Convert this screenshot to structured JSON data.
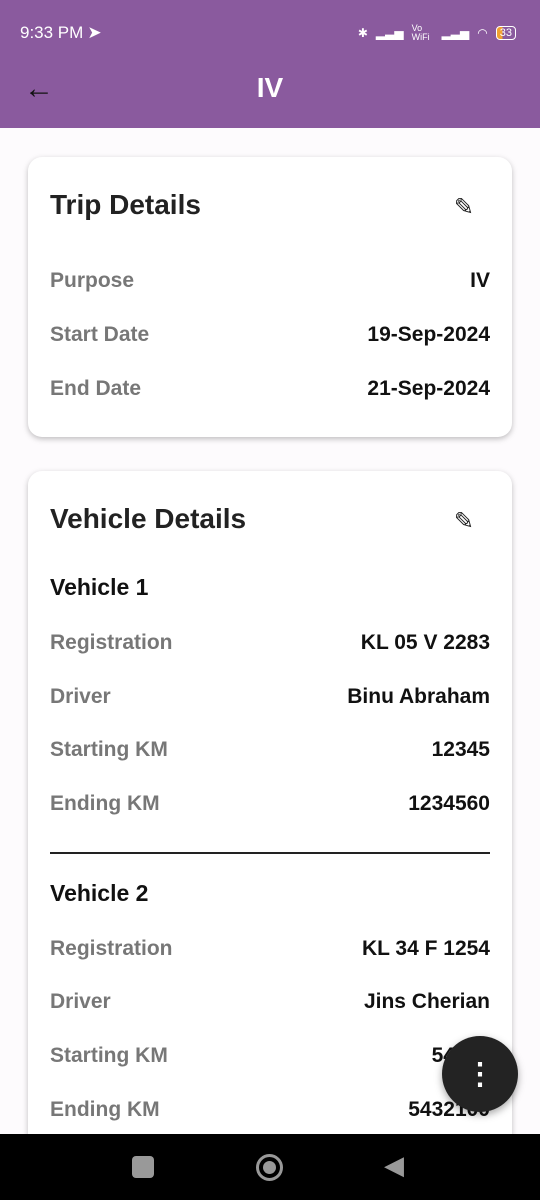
{
  "status": {
    "time": "9:33 PM",
    "battery": "33",
    "vowifi": "Vo WiFi"
  },
  "appbar": {
    "title": "IV"
  },
  "trip": {
    "title": "Trip Details",
    "rows": [
      {
        "label": "Purpose",
        "value": "IV"
      },
      {
        "label": "Start Date",
        "value": "19-Sep-2024"
      },
      {
        "label": "End Date",
        "value": "21-Sep-2024"
      }
    ]
  },
  "vehicles": {
    "title": "Vehicle Details",
    "list": [
      {
        "name": "Vehicle 1",
        "rows": [
          {
            "label": "Registration",
            "value": "KL 05 V 2283"
          },
          {
            "label": "Driver",
            "value": "Binu Abraham"
          },
          {
            "label": "Starting KM",
            "value": "12345"
          },
          {
            "label": "Ending KM",
            "value": "1234560"
          }
        ]
      },
      {
        "name": "Vehicle 2",
        "rows": [
          {
            "label": "Registration",
            "value": "KL 34 F 1254"
          },
          {
            "label": "Driver",
            "value": "Jins Cherian"
          },
          {
            "label": "Starting KM",
            "value": "54321"
          },
          {
            "label": "Ending KM",
            "value": "5432100"
          }
        ]
      }
    ]
  }
}
